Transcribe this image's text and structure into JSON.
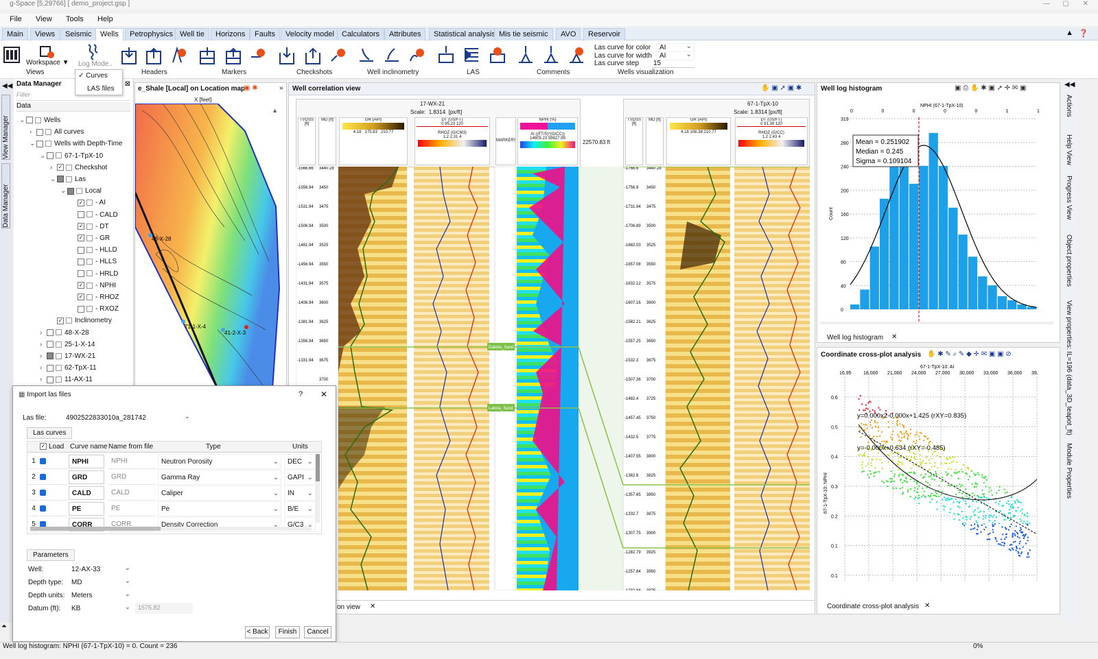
{
  "window": {
    "title": "g-Space [5.29766] [ demo_project.gsp ]"
  },
  "menu": [
    "File",
    "View",
    "Tools",
    "Help"
  ],
  "ribbon_tabs": [
    "Main",
    "Views",
    "Seismic",
    "Wells",
    "Petrophysics",
    "Well tie",
    "Horizons",
    "Faults",
    "Velocity model",
    "Calculators",
    "Attributes",
    "Statistical analysis",
    "Mis tie seismic",
    "AVO",
    "Reservoir"
  ],
  "active_tab": "Wells",
  "ribbon": {
    "workspace_label": "Workspace ▼",
    "log_mode_label": "Log Mode..",
    "views_label": "Views",
    "view_menu": [
      "Curves",
      "LAS files"
    ],
    "groups": [
      "Headers",
      "Markers",
      "Checkshots",
      "Well inclinometry",
      "LAS",
      "Comments",
      "Wells visualization"
    ],
    "las_color_label": "Las curve for color",
    "las_color_value": "AI",
    "las_width_label": "Las curve for width",
    "las_width_value": "AI",
    "las_step_label": "Las curve step",
    "las_step_value": "15"
  },
  "data_manager": {
    "title": "Data Manager",
    "filter_placeholder": "Filter",
    "column": "Data",
    "tree": [
      {
        "label": "Wells",
        "lvl": 0,
        "exp": "⌄"
      },
      {
        "label": "All curves",
        "lvl": 1,
        "exp": "›"
      },
      {
        "label": "Wells with Depth-Time",
        "lvl": 1,
        "exp": "⌄"
      },
      {
        "label": "67-1-TpX-10",
        "lvl": 2,
        "exp": "⌄"
      },
      {
        "label": "Checkshot",
        "lvl": 3,
        "exp": "›",
        "chk": "on"
      },
      {
        "label": "Las",
        "lvl": 3,
        "exp": "⌄",
        "chk": "half"
      },
      {
        "label": "Local",
        "lvl": 4,
        "exp": "⌄",
        "chk": "half"
      },
      {
        "label": "- AI",
        "lvl": 5,
        "chk": "on"
      },
      {
        "label": "- CALD",
        "lvl": 5,
        "chk": "off"
      },
      {
        "label": "- DT",
        "lvl": 5,
        "chk": "on"
      },
      {
        "label": "- GR",
        "lvl": 5,
        "chk": "on"
      },
      {
        "label": "- HLLD",
        "lvl": 5,
        "chk": "off"
      },
      {
        "label": "- HLLS",
        "lvl": 5,
        "chk": "off"
      },
      {
        "label": "- HRLD",
        "lvl": 5,
        "chk": "off"
      },
      {
        "label": "- NPHI",
        "lvl": 5,
        "chk": "on"
      },
      {
        "label": "- RHOZ",
        "lvl": 5,
        "chk": "on"
      },
      {
        "label": "- RXOZ",
        "lvl": 5,
        "chk": "off"
      },
      {
        "label": "Inclinometry",
        "lvl": 3,
        "chk": "on"
      },
      {
        "label": "48-X-28",
        "lvl": 2,
        "exp": "›"
      },
      {
        "label": "25-1-X-14",
        "lvl": 2,
        "exp": "›"
      },
      {
        "label": "17-WX-21",
        "lvl": 2,
        "exp": "›",
        "chk": "half"
      },
      {
        "label": "62-TpX-11",
        "lvl": 2,
        "exp": "›"
      },
      {
        "label": "11-AX-11",
        "lvl": 2,
        "exp": "›"
      }
    ]
  },
  "side_tabs_left": [
    "View Manager",
    "Data Manager"
  ],
  "map": {
    "title": "e_Shale [Local] on Location map",
    "axis": "X [feet]",
    "wells": [
      "48-X-28",
      "71-1-X-4",
      "41-2-X-3"
    ]
  },
  "correlation": {
    "title": "Well correlation view",
    "well1": "17-WX-21",
    "well2": "67-1-TpX-10",
    "scale_label": "Scale:",
    "scale_value": "1.8314",
    "scale_unit": "[px/ft]",
    "distance": "22570.83 ft",
    "tvdss": "TVDSS [ft]",
    "md": "MD [ft]",
    "markers": "MARKERS",
    "gr_hdr": "GR (API)",
    "gr_min": "4.18",
    "gr_max1": "210.77",
    "gr_val1": "175.83",
    "gr_val2": "108.38",
    "dt_hdr": "DT (US/FT)",
    "dt_min": "0",
    "dt_max": "120",
    "dt_val1": "95.23",
    "dt_val2": "91.39",
    "rhoz_hdr1": "RHOZ (G/CM3)",
    "rhoz_hdr2": "RHOZ (G/CC)",
    "rhoz_min": "1.2",
    "rhoz_max": "4",
    "rhoz_val1": "2.31",
    "rhoz_val2": "2.43",
    "nphi_hdr": "NPHI (%)",
    "nphi_min": "0.6",
    "ai_hdr": "AI ((FT/S)*(G/CC))",
    "ai_min": "14605.23",
    "ai_max": "59827.99",
    "ai_val": "24302.25",
    "marker1": "Dakota_Sand",
    "marker2": "Lakota_Sand",
    "depths1": [
      "-1566.66",
      "-1556.94",
      "-1531.94",
      "-1506.94",
      "-1481.94",
      "-1456.94",
      "-1431.94",
      "-1406.94",
      "-1381.94",
      "-1356.94",
      "-1331.94"
    ],
    "md1": [
      "3440.28",
      "3450",
      "3475",
      "3500",
      "3525",
      "3550",
      "3575",
      "3600",
      "3625",
      "3650",
      "3675",
      "3700"
    ],
    "depths2": [
      "-1766.6",
      "-1756.9",
      "-1731.94",
      "-1706.89",
      "-1682.03",
      "-1657.08",
      "-1632.12",
      "-1607.16",
      "-1582.21",
      "-1557.25",
      "-1532.3",
      "-1507.36",
      "-1482.4",
      "-1457.45",
      "-1432.5",
      "-1407.55",
      "-1382.6",
      "-1357.65",
      "-1332.7",
      "-1307.75",
      "-1282.79",
      "-1257.84",
      "-1232.88"
    ],
    "md2": [
      "3440.28",
      "3450",
      "3475",
      "3500",
      "3525",
      "3550",
      "3575",
      "3600",
      "3625",
      "3650",
      "3675",
      "3700",
      "3725",
      "3750",
      "3775",
      "3800",
      "3825",
      "3850",
      "3875",
      "3900",
      "3925",
      "3950",
      "3975"
    ],
    "bottom_tab": "on view"
  },
  "histogram": {
    "title": "Well log histogram",
    "subtitle": "NPHI (67-1-TpX-10)",
    "ylabel": "Count",
    "mean": "Mean = 0.251902",
    "median": "Median = 0.245",
    "sigma": "Sigma = 0.109104",
    "yticks": [
      "0",
      "40",
      "80",
      "120",
      "160",
      "200",
      "240",
      "280",
      "319"
    ],
    "xticks": [
      "0",
      "0",
      "0",
      "0",
      "0",
      "1",
      "1"
    ],
    "tab": "Well log histogram"
  },
  "crossplot": {
    "title": "Coordinate cross-plot analysis",
    "xlabel": "67-1-TpX-10: AI",
    "ylabel": "67-1-TpX-10: NPHI",
    "xticks": [
      "16,95",
      "18,000",
      "21,000",
      "24,000",
      "27,000",
      "30,000",
      "33,000",
      "36,000",
      "39,"
    ],
    "yticks": [
      "0.6",
      "0.5",
      "0.4",
      "0.3",
      "0.2",
      "0.1",
      "0.1"
    ],
    "eq1": "y=0.000x2-0.000x+1.425 (rXY=0.835)",
    "eq2": "y=-0.000x+0.634 (rXY=-0.485)",
    "tab": "Coordinate cross-plot analysis"
  },
  "side_tabs_right": [
    "Actions",
    "Help View",
    "Progress View",
    "Object properties",
    "View properties: IL=196 (data_3D_teapot_ft)",
    "Module Properties"
  ],
  "dialog": {
    "title": "Import las files",
    "help": "?",
    "close": "✕",
    "las_file_label": "Las file:",
    "las_file_value": "4902522833010a_281742",
    "curves_tab": "Las curves",
    "columns": [
      "Load",
      "Curve name",
      "Name from file",
      "Type",
      "Units"
    ],
    "rows": [
      {
        "n": "1",
        "curve": "NPHI",
        "file": "NPHI",
        "type": "Neutron Porosity",
        "units": "DEC"
      },
      {
        "n": "2",
        "curve": "GRD",
        "file": "GRD",
        "type": "Gamma Ray",
        "units": "GAPI"
      },
      {
        "n": "3",
        "curve": "CALD",
        "file": "CALD",
        "type": "Caliper",
        "units": "IN"
      },
      {
        "n": "4",
        "curve": "PE",
        "file": "PE",
        "type": "Pe",
        "units": "B/E"
      },
      {
        "n": "5",
        "curve": "CORR",
        "file": "CORR",
        "type": "Density Correction",
        "units": "G/C3"
      }
    ],
    "params_tab": "Parameters",
    "well_label": "Well:",
    "well_value": "12-AX-33",
    "depth_type_label": "Depth type:",
    "depth_type_value": "MD",
    "depth_units_label": "Depth units:",
    "depth_units_value": "Meters",
    "datum_label": "Datum (ft):",
    "datum_value": "KB",
    "datum_number": "1575.82",
    "back": "< Back",
    "finish": "Finish",
    "cancel": "Cancel"
  },
  "status": {
    "text": "Well log histogram: NPHI (67-1-TpX-10) = 0. Count = 236",
    "percent": "0%"
  }
}
